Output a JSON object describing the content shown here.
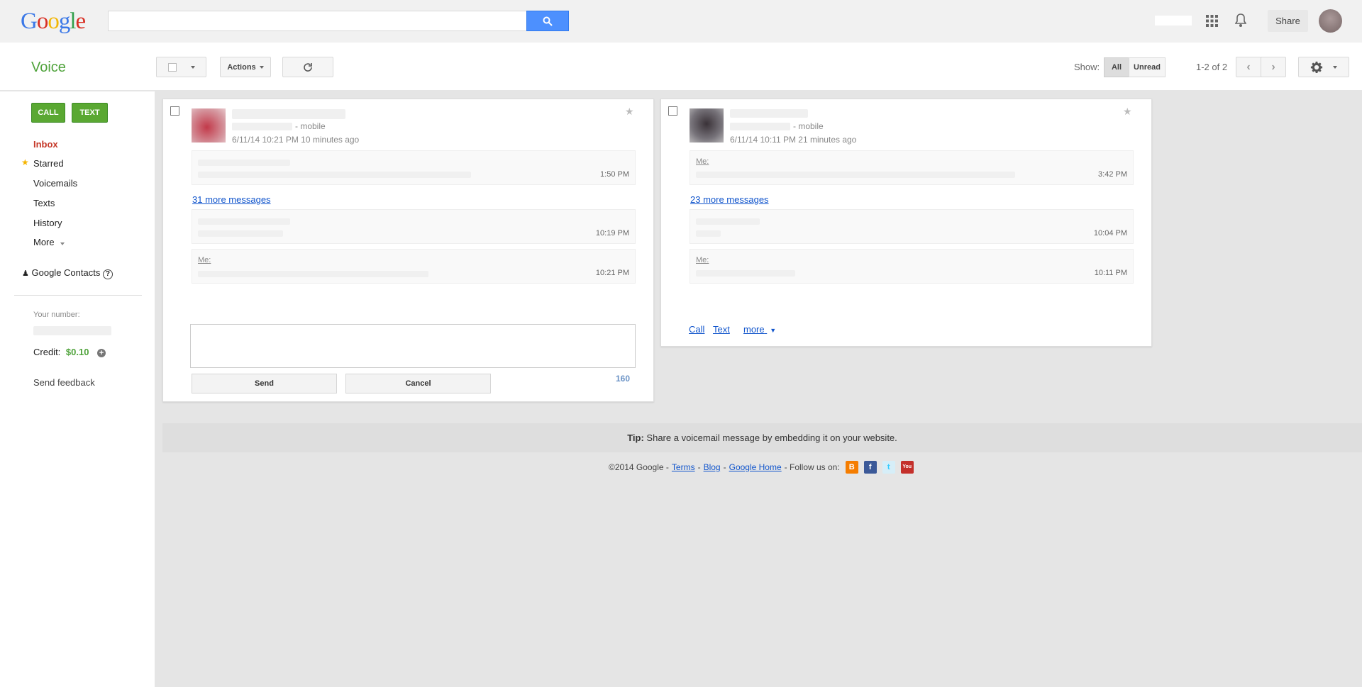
{
  "header": {
    "logo_letters": [
      {
        "ch": "G",
        "color": "#3b78e7"
      },
      {
        "ch": "o",
        "color": "#d93025"
      },
      {
        "ch": "o",
        "color": "#f2b705"
      },
      {
        "ch": "g",
        "color": "#3b78e7"
      },
      {
        "ch": "l",
        "color": "#33a04d"
      },
      {
        "ch": "e",
        "color": "#d93025"
      }
    ],
    "search_placeholder": "",
    "search_icon": "search-icon",
    "apps_icon": "apps-grid-icon",
    "bell_icon": "bell-icon",
    "share_label": "Share"
  },
  "toolbar": {
    "app_title": "Voice",
    "actions_label": "Actions",
    "refresh_icon": "refresh-icon",
    "show_label": "Show:",
    "filter_all": "All",
    "filter_unread": "Unread",
    "page_count": "1-2 of 2",
    "settings_icon": "gear-icon"
  },
  "sidebar": {
    "call_label": "CALL",
    "text_label": "TEXT",
    "items": [
      {
        "label": "Inbox"
      },
      {
        "label": "Starred"
      },
      {
        "label": "Voicemails"
      },
      {
        "label": "Texts"
      },
      {
        "label": "History"
      },
      {
        "label": "More"
      }
    ],
    "contacts_label": "Google Contacts",
    "your_number_label": "Your number:",
    "credit_label": "Credit:",
    "credit_value": "$0.10",
    "feedback_label": "Send feedback"
  },
  "conversations": [
    {
      "phone_type": "- mobile",
      "timestamp": "6/11/14 10:21 PM 10 minutes ago",
      "first_msg_time": "1:50 PM",
      "more_messages": "31 more messages",
      "msg2_time": "10:19 PM",
      "me_label": "Me:",
      "msg3_time": "10:21 PM",
      "send_label": "Send",
      "cancel_label": "Cancel",
      "char_count": "160"
    },
    {
      "phone_type": "- mobile",
      "timestamp": "6/11/14 10:11 PM 21 minutes ago",
      "me_label": "Me:",
      "first_msg_time": "3:42 PM",
      "more_messages": "23 more messages",
      "msg2_time": "10:04 PM",
      "msg3_time": "10:11 PM",
      "call_link": "Call",
      "text_link": "Text",
      "more_link": "more"
    }
  ],
  "tip": {
    "bold": "Tip:",
    "text": "Share a voicemail message by embedding it on your website."
  },
  "footer": {
    "copyright": "©2014 Google -",
    "terms": "Terms",
    "blog": "Blog",
    "home": "Google Home",
    "follow": "- Follow us on:",
    "sep": "-"
  }
}
